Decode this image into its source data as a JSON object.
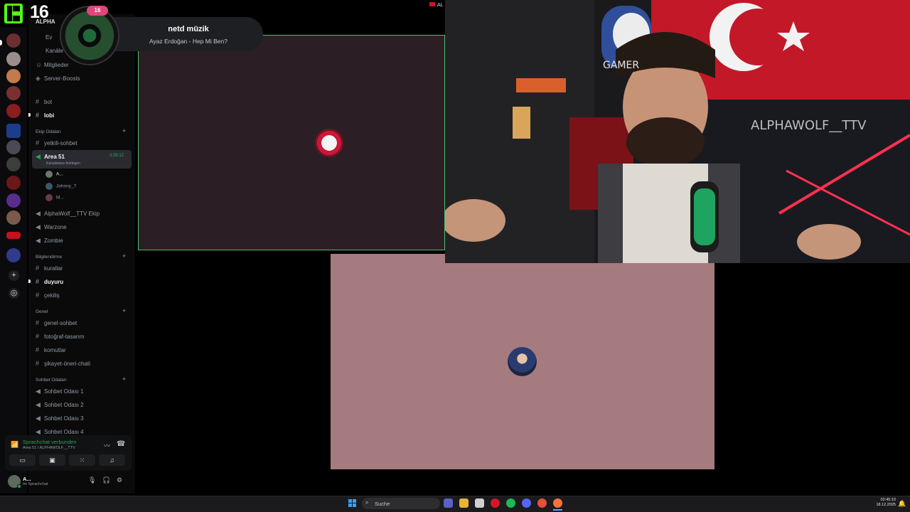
{
  "window": {
    "title_short": "AL"
  },
  "overlay": {
    "kick_number": "16",
    "toast_title": "netd müzik",
    "toast_subtitle": "Ayaz Erdoğan - Hep Mi Ben?",
    "disc_badge": "16"
  },
  "guild": {
    "name": "ALPHA"
  },
  "sidebar": {
    "top_items": [
      {
        "label": "Ev"
      },
      {
        "label": "Kanäle"
      },
      {
        "label": "Mitglieder"
      },
      {
        "label": "Server-Boosts"
      }
    ],
    "channels_a": [
      {
        "label": "bot"
      },
      {
        "label": "lobi"
      }
    ],
    "category_ekip": "Ekip Odaları",
    "ekip_channels": [
      {
        "label": "yetkili-sohbet"
      }
    ],
    "active_voice": {
      "label": "Area 51",
      "timer": "3:38:12",
      "status": "Kanalstatus festlegen"
    },
    "voice_users": [
      {
        "name": "A..."
      },
      {
        "name": "Johnny_7"
      },
      {
        "name": "M..."
      }
    ],
    "ekip_voice": [
      {
        "label": "AlphaWolf__TTV Ekip"
      },
      {
        "label": "Warzone"
      },
      {
        "label": "Zombie"
      }
    ],
    "category_bilgi": "Bilgilendirme",
    "bilgi_channels": [
      {
        "label": "kurallar"
      },
      {
        "label": "duyuru"
      },
      {
        "label": "çekiliş"
      }
    ],
    "category_genel": "Genel",
    "genel_channels": [
      {
        "label": "genel-sohbet"
      },
      {
        "label": "fotoğraf-tasarım"
      },
      {
        "label": "komutlar"
      },
      {
        "label": "şikayet-öneri-chati"
      }
    ],
    "category_sohbet": "Sohbet Odaları",
    "sohbet_channels": [
      {
        "label": "Sohbet Odası 1"
      },
      {
        "label": "Sohbet Odası 2"
      },
      {
        "label": "Sohbet Odası 3"
      },
      {
        "label": "Sohbet Odası 4"
      }
    ]
  },
  "voice_panel": {
    "status": "Sprachchat verbunden",
    "location": "Area 51 / ALPHAWOLF__TTV"
  },
  "user_panel": {
    "name": "A...",
    "status": "Im Sprachchat"
  },
  "webcam": {
    "flag_text": "ALPHAWOLF__TTV",
    "mask_text": "GAMER"
  },
  "taskbar": {
    "search_placeholder": "Suche",
    "time": "02:45:10",
    "date": "18.12.2025"
  },
  "colors": {
    "accent_green": "#53fc18",
    "voice_green": "#23a55a",
    "tile_pink": "#a67b80",
    "tile_dark": "#2b1f25"
  }
}
